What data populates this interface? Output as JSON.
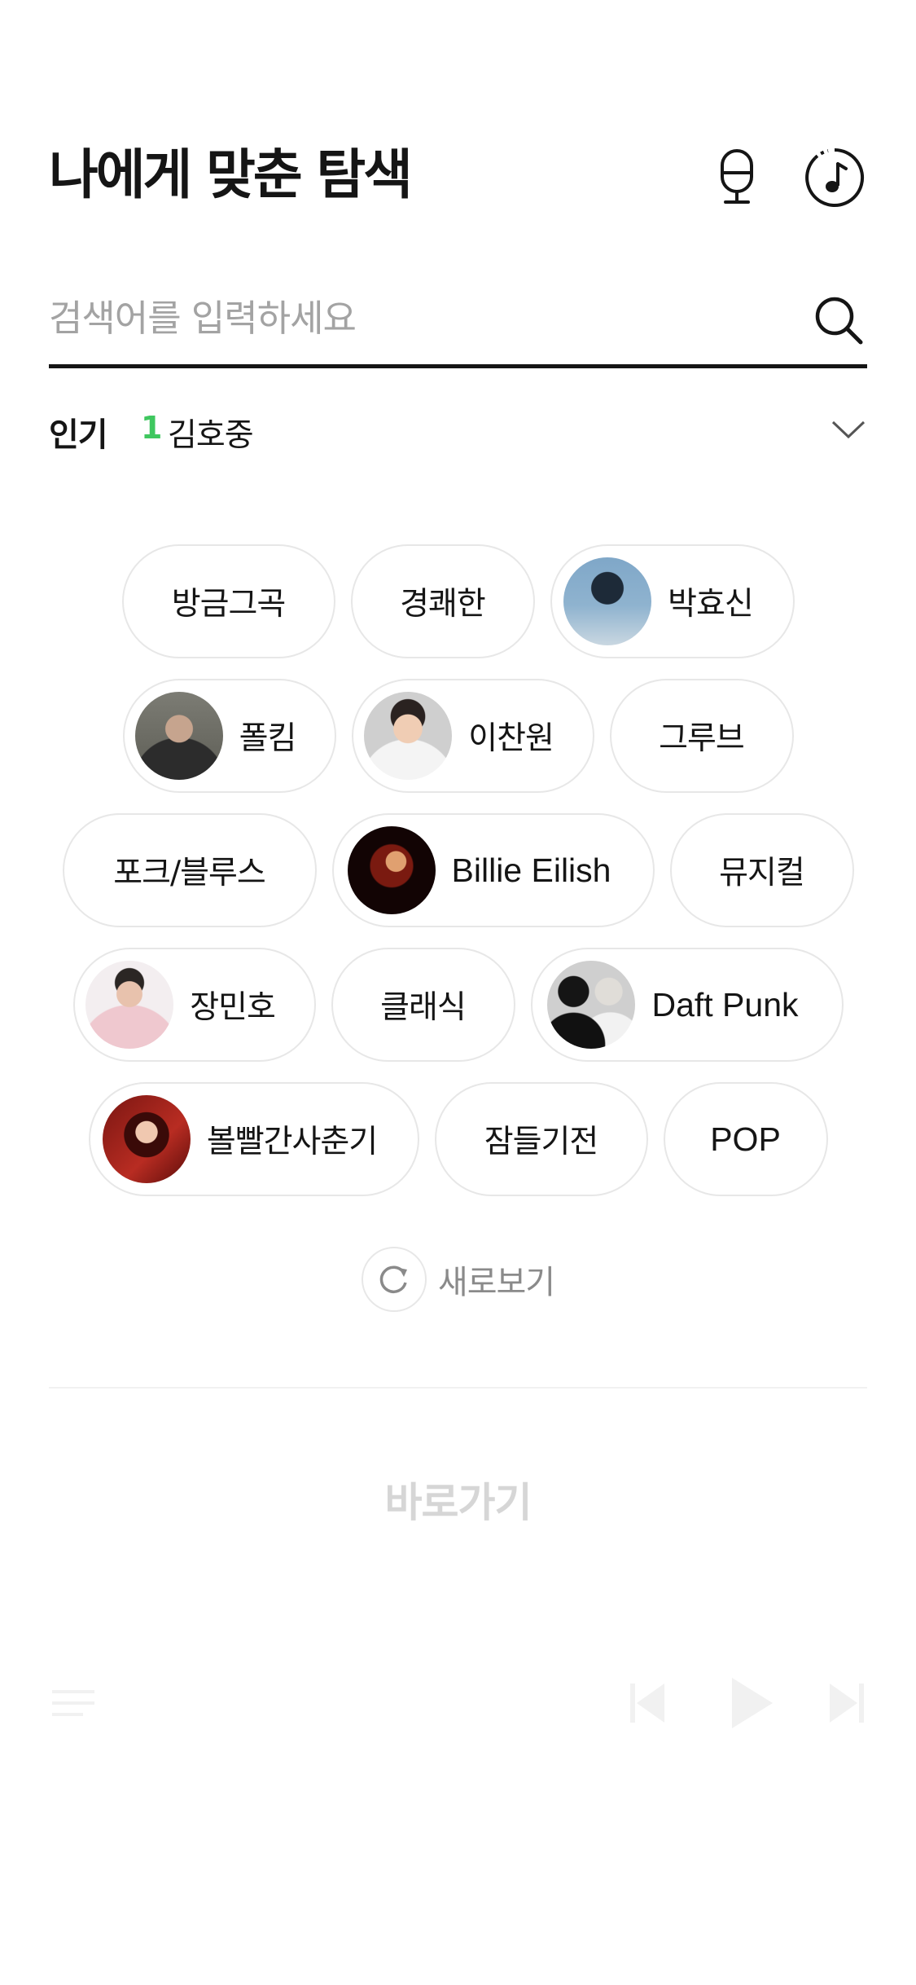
{
  "header": {
    "title": "나에게 맞춘 탐색",
    "icons": [
      "microphone-icon",
      "music-recognition-icon"
    ]
  },
  "search": {
    "placeholder": "검색어를 입력하세요",
    "value": "",
    "icon": "search-icon"
  },
  "popular": {
    "label": "인기",
    "rank": "1",
    "term": "김호중",
    "toggle_icon": "chevron-down-icon",
    "accent_color": "#3fc75f"
  },
  "chips": {
    "rows": [
      [
        {
          "label": "방금그곡"
        },
        {
          "label": "경쾌한"
        },
        {
          "label": "박효신",
          "avatar": "artist-photo"
        }
      ],
      [
        {
          "label": "폴킴",
          "avatar": "artist-photo"
        },
        {
          "label": "이찬원",
          "avatar": "artist-photo"
        },
        {
          "label": "그루브"
        }
      ],
      [
        {
          "label": "포크/블루스"
        },
        {
          "label": "Billie Eilish",
          "avatar": "artist-photo"
        },
        {
          "label": "뮤지컬"
        }
      ],
      [
        {
          "label": "장민호",
          "avatar": "artist-photo"
        },
        {
          "label": "클래식"
        },
        {
          "label": "Daft Punk",
          "avatar": "artist-photo"
        }
      ],
      [
        {
          "label": "볼빨간사춘기",
          "avatar": "artist-photo"
        },
        {
          "label": "잠들기전"
        },
        {
          "label": "POP"
        }
      ]
    ]
  },
  "refresh": {
    "label": "새로보기",
    "icon": "refresh-icon"
  },
  "shortcuts": {
    "title": "바로가기"
  },
  "player": {
    "icons": [
      "playlist-icon",
      "previous-icon",
      "play-icon",
      "next-icon"
    ]
  }
}
